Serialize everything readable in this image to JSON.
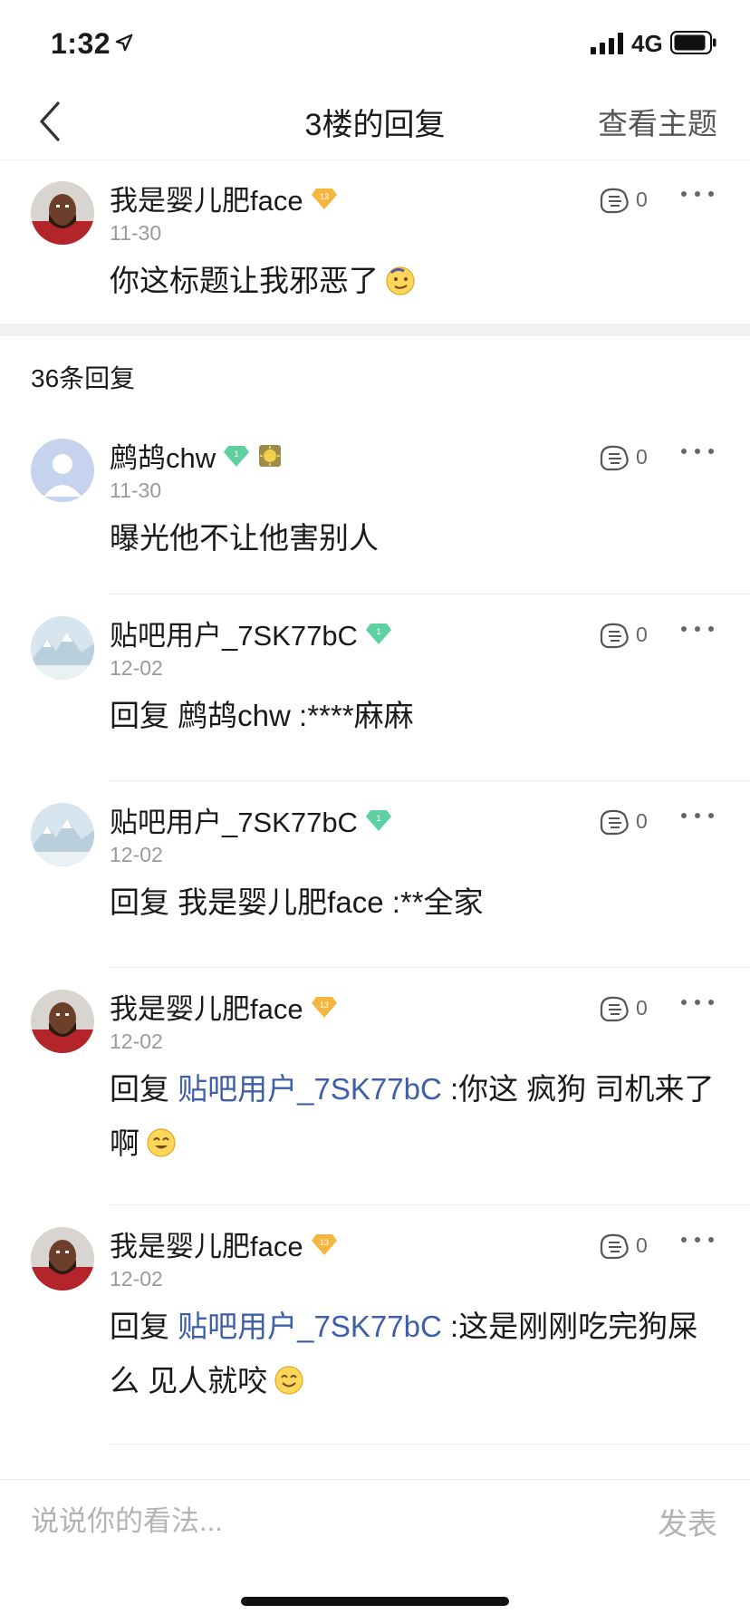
{
  "status_bar": {
    "time": "1:32",
    "network": "4G"
  },
  "nav": {
    "title": "3楼的回复",
    "action": "查看主题"
  },
  "main_post": {
    "username": "我是婴儿肥face",
    "level": "13",
    "date": "11-30",
    "text": "你这标题让我邪恶了",
    "likes": "0"
  },
  "reply_count": "36条回复",
  "replies": [
    {
      "username": "鹧鸪chw",
      "level": "1",
      "date": "11-30",
      "text": "曝光他不让他害别人",
      "likes": "0"
    },
    {
      "username": "贴吧用户_7SK77bC",
      "level": "1",
      "date": "12-02",
      "prefix": "回复 鹧鸪chw :",
      "text": "****麻麻",
      "likes": "0"
    },
    {
      "username": "贴吧用户_7SK77bC",
      "level": "1",
      "date": "12-02",
      "prefix": "回复 我是婴儿肥face :",
      "text": "**全家",
      "likes": "0"
    },
    {
      "username": "我是婴儿肥face",
      "level": "13",
      "date": "12-02",
      "reply_word": "回复 ",
      "mention": "贴吧用户_7SK77bC",
      "text": " :你这 疯狗 司机来了啊",
      "likes": "0"
    },
    {
      "username": "我是婴儿肥face",
      "level": "13",
      "date": "12-02",
      "reply_word": "回复 ",
      "mention": "贴吧用户_7SK77bC",
      "text": " :这是刚刚吃完狗屎么 见人就咬",
      "likes": "0"
    }
  ],
  "bottom_bar": {
    "placeholder": "说说你的看法...",
    "send": "发表"
  },
  "colors": {
    "mention": "#3d5ea8",
    "level_badge": "#f5b640",
    "green_badge": "#5fd0a2",
    "divider": "#f2f2f4"
  }
}
